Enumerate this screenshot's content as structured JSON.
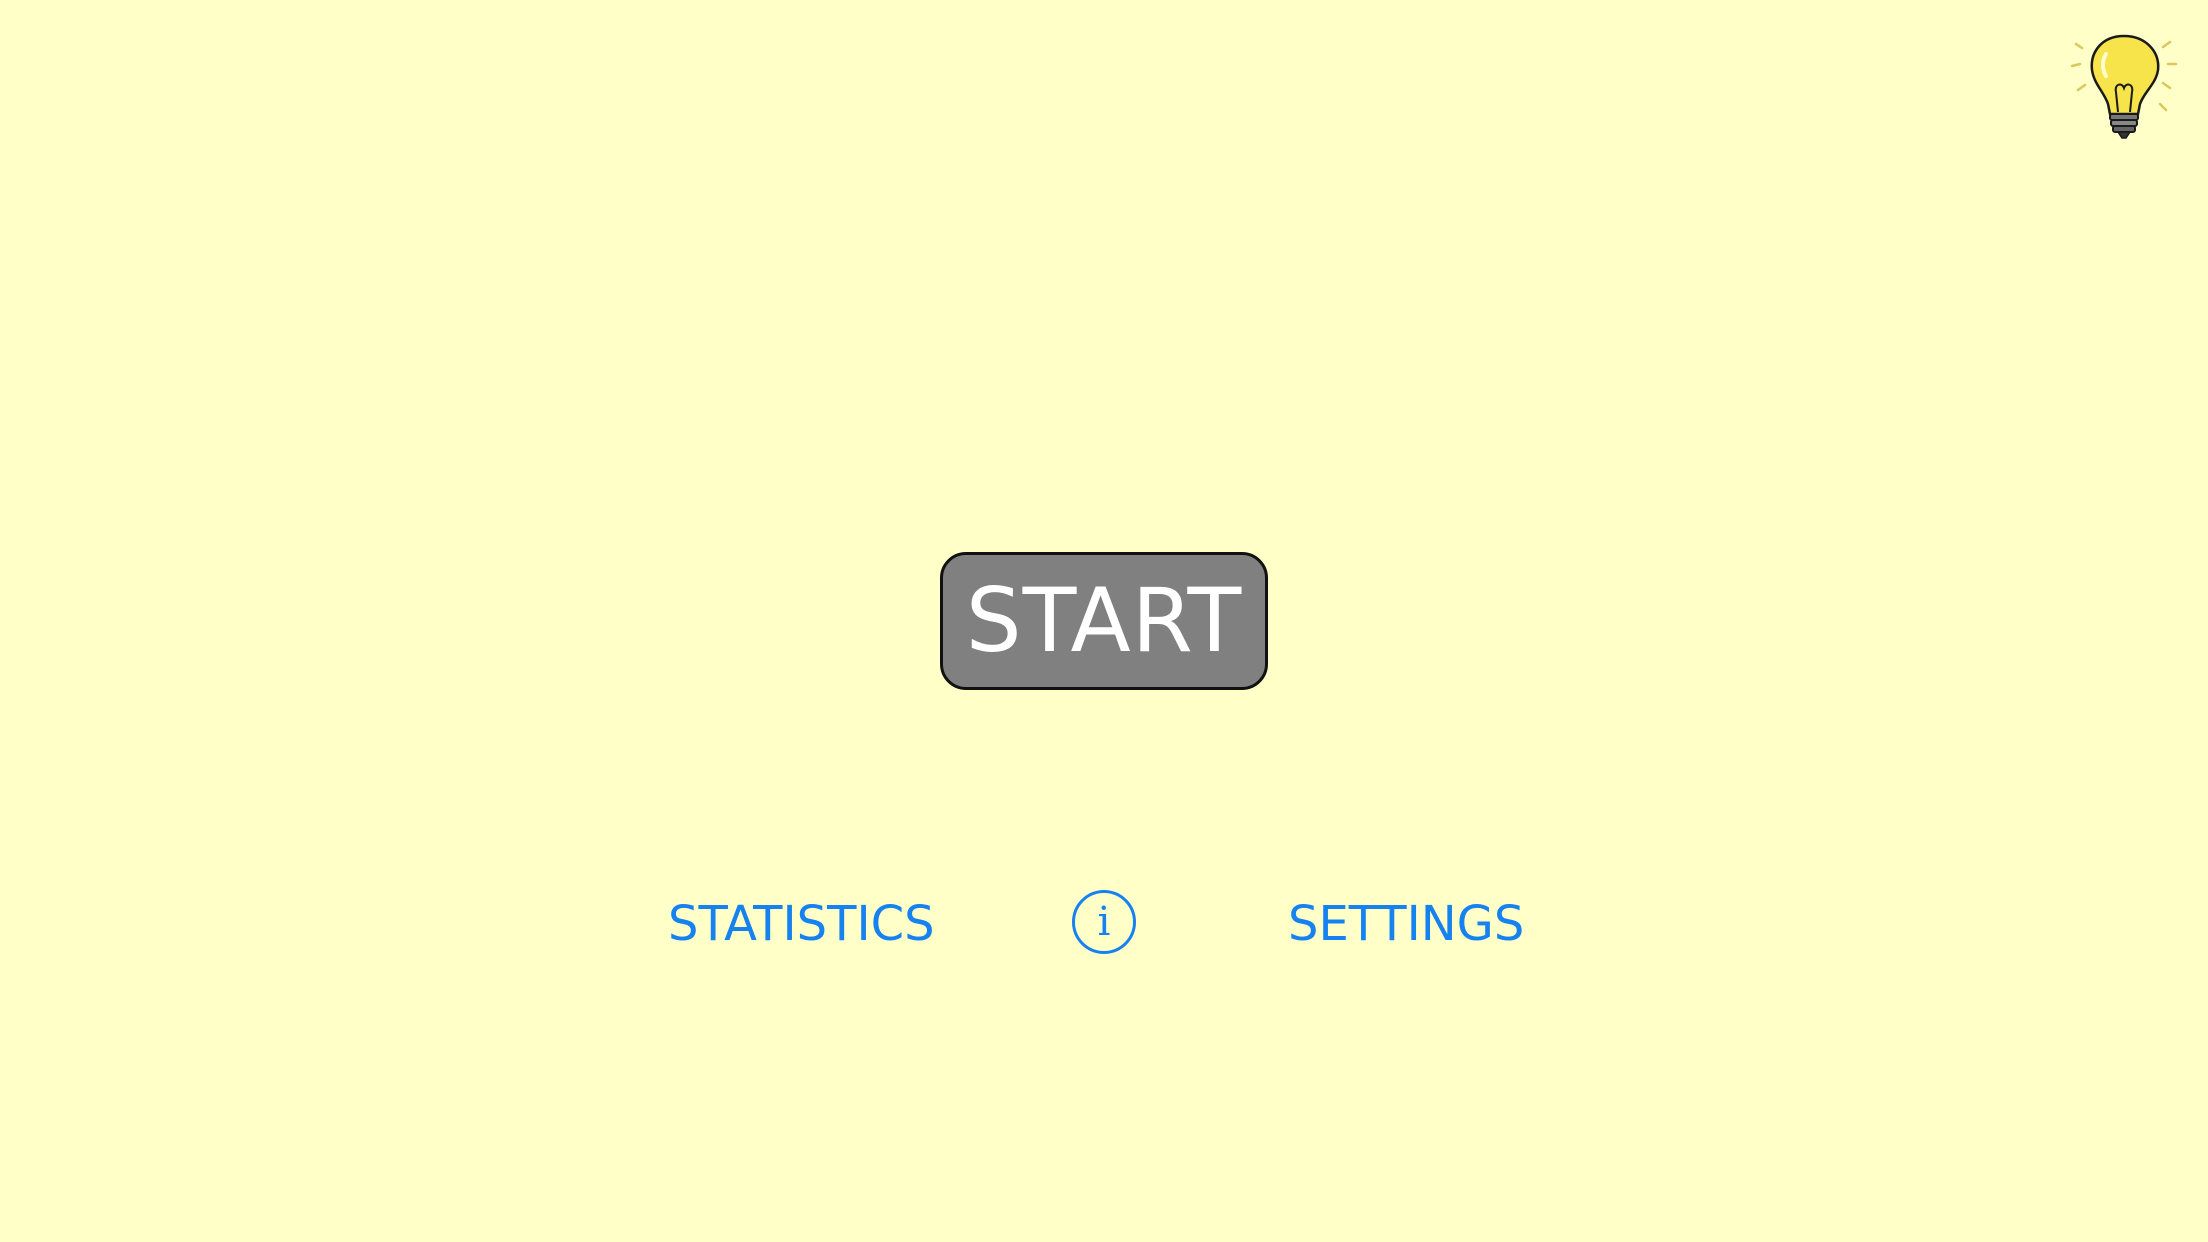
{
  "screen": {
    "background_color": "#FFFFC8"
  },
  "hint": {
    "icon": "lightbulb-icon"
  },
  "start": {
    "label": "START",
    "background_color": "#808080"
  },
  "footer": {
    "statistics_label": "STATISTICS",
    "info_icon": "info-icon",
    "info_glyph": "i",
    "settings_label": "SETTINGS",
    "link_color": "#1682F0"
  }
}
